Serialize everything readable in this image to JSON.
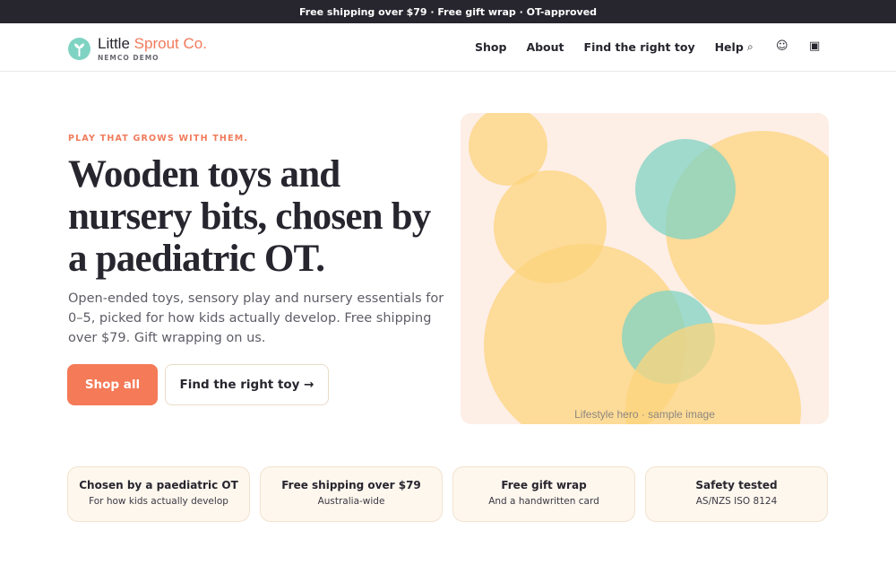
{
  "announcement": "Free shipping over $79 · Free gift wrap · OT-approved",
  "brand": {
    "name_part1": "Little",
    "name_part2": "Sprout Co.",
    "subtitle": "NEMCO DEMO",
    "logo_icon": "sprout-icon"
  },
  "nav": {
    "items": [
      "Shop",
      "About",
      "Find the right toy",
      "Help"
    ]
  },
  "header_icons": {
    "search": "⌕",
    "account": "☺",
    "cart": "▣"
  },
  "hero": {
    "eyebrow": "PLAY THAT GROWS WITH THEM.",
    "headline": "Wooden toys and nursery bits, chosen by a paediatric OT.",
    "lede": "Open-ended toys, sensory play and nursery essentials for 0–5, picked for how kids actually develop. Free shipping over $79. Gift wrapping on us.",
    "primary_cta": "Shop all",
    "secondary_cta": "Find the right toy →",
    "image_caption": "Lifestyle hero · sample image"
  },
  "features": [
    {
      "title": "Chosen by a paediatric OT",
      "subtitle": "For how kids actually develop"
    },
    {
      "title": "Free shipping over $79",
      "subtitle": "Australia-wide"
    },
    {
      "title": "Free gift wrap",
      "subtitle": "And a handwritten card"
    },
    {
      "title": "Safety tested",
      "subtitle": "AS/NZS ISO 8124"
    }
  ],
  "colors": {
    "accent": "#f47a58",
    "brand_orange": "#f07a5a",
    "teal": "#7fd3c3",
    "topbar_bg": "#27252e",
    "hero_bg": "#fdeee6",
    "circle_yellow": "#fcd47e",
    "feature_bg": "#fef7ee"
  }
}
